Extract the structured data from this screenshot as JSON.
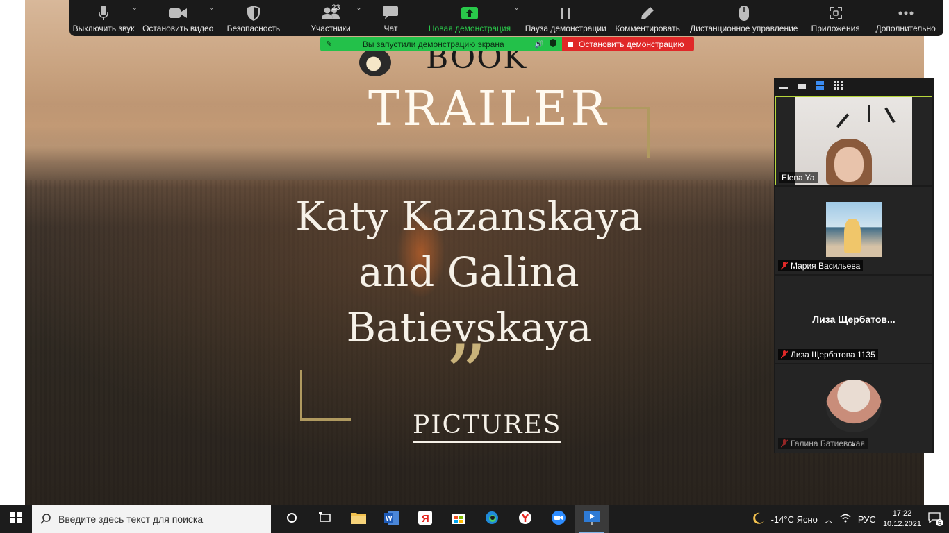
{
  "toolbar": {
    "items": [
      {
        "label": "Выключить звук"
      },
      {
        "label": "Остановить видео"
      },
      {
        "label": "Безопасность"
      },
      {
        "label": "Участники",
        "count": "23"
      },
      {
        "label": "Чат"
      },
      {
        "label": "Новая демонстрация"
      },
      {
        "label": "Пауза демонстрации"
      },
      {
        "label": "Комментировать"
      },
      {
        "label": "Дистанционное управление"
      },
      {
        "label": "Приложения"
      },
      {
        "label": "Дополнительно"
      }
    ],
    "accent_green": "#29c94a"
  },
  "share_banner": {
    "message": "Вы запустили демонстрацию экрана",
    "stop_label": "Остановить демонстрацию",
    "green": "#23c14a",
    "red": "#e02828"
  },
  "slide": {
    "book": "BOOK",
    "trailer": "TRAILER",
    "authors_line1": "Katy Kazanskaya",
    "authors_line2": "and Galina",
    "authors_line3": "Batievskaya",
    "quote_mark": "”",
    "pictures": "PICTURES"
  },
  "panel": {
    "participants": [
      {
        "name": "Elena Ya"
      },
      {
        "name": "Мария Васильева"
      },
      {
        "name": "Лиза Щербатова 1135",
        "display_name": "Лиза  Щербатов..."
      },
      {
        "name": "Галина Батиевская"
      }
    ]
  },
  "taskbar": {
    "search_placeholder": "Введите здесь текст для поиска",
    "weather": "-14°C  Ясно",
    "language": "РУС",
    "time": "17:22",
    "date": "10.12.2021",
    "notifications": "6"
  }
}
